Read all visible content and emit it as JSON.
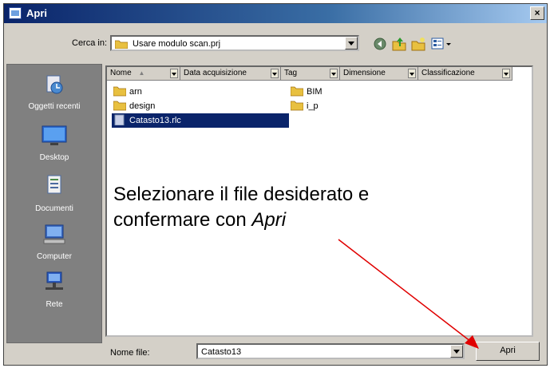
{
  "window": {
    "title": "Apri",
    "close_glyph": "×"
  },
  "toolbar": {
    "lookin_label": "Cerca in:",
    "lookin_value": "Usare modulo scan.prj",
    "icons": [
      "back-icon",
      "up-folder-icon",
      "new-folder-icon",
      "view-menu-icon"
    ]
  },
  "places": [
    {
      "label": "Oggetti recenti",
      "icon": "recent-items-icon"
    },
    {
      "label": "Desktop",
      "icon": "desktop-icon"
    },
    {
      "label": "Documenti",
      "icon": "documents-icon"
    },
    {
      "label": "Computer",
      "icon": "computer-icon"
    },
    {
      "label": "Rete",
      "icon": "network-icon"
    }
  ],
  "columns": [
    "Nome",
    "Data acquisizione",
    "Tag",
    "Dimensione",
    "Classificazione"
  ],
  "files": [
    {
      "name": "arn",
      "type": "folder"
    },
    {
      "name": "design",
      "type": "folder"
    },
    {
      "name": "Catasto13.rlc",
      "type": "file",
      "selected": true
    },
    {
      "name": "BIM",
      "type": "folder"
    },
    {
      "name": "i_p",
      "type": "folder"
    }
  ],
  "filename": {
    "label": "Nome file:",
    "value": "Catasto13"
  },
  "open_button": "Apri",
  "annotation": {
    "line1": "Selezionare  il file desiderato e",
    "line2_prefix": "confermare con ",
    "line2_italic": "Apri"
  },
  "colors": {
    "arrow": "#e00000",
    "selection": "#0a246a",
    "title_bar": "#0a246a"
  }
}
